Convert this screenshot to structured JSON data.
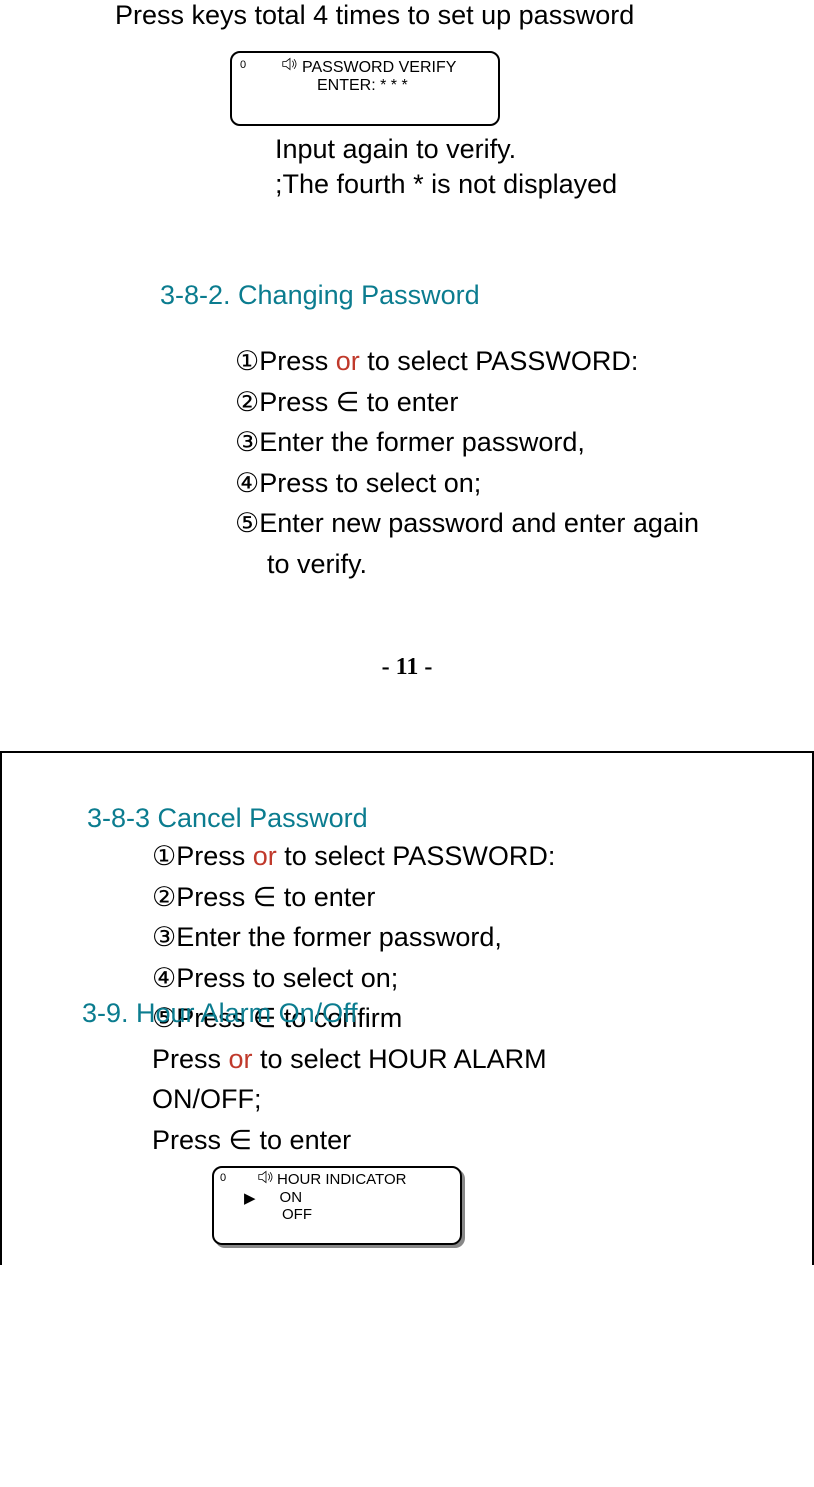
{
  "top": {
    "intro": "Press keys total 4 times to set up password",
    "display": {
      "corner": "0",
      "line1": "PASSWORD VERIFY",
      "line2": "ENTER: * * *"
    },
    "caption1": "Input again to verify.",
    "caption2": ";The fourth * is not displayed"
  },
  "section1": {
    "heading": "3-8-2. Changing Password",
    "step1_a": "①Press ",
    "step1_or": " or ",
    "step1_b": " to select PASSWORD:",
    "step2": "②Press ∈ to enter",
    "step3": "③Enter the former password,",
    "step4": "④Press    to select on;",
    "step5": "⑤Enter new password and enter again",
    "step5b": "to verify."
  },
  "page_num": "- 11 -",
  "section2": {
    "heading": "3-8-3 Cancel Password",
    "step1_a": "①Press ",
    "step1_or": " or ",
    "step1_b": " to select PASSWORD:",
    "step2": "②Press ∈ to enter",
    "step3": "③Enter the former password,",
    "step4": "④Press    to select on;",
    "step5": "⑤Press ∈ to confirm"
  },
  "section3": {
    "heading": "3-9. Hour Alarm On/Off",
    "line1_a": "Press ",
    "line1_or": " or ",
    "line1_b": " to select HOUR ALARM",
    "line2": "ON/OFF;",
    "line3": "Press ∈ to enter",
    "display": {
      "corner": "0",
      "line1": "HOUR INDICATOR",
      "line2": "ON",
      "line3": "OFF"
    }
  }
}
